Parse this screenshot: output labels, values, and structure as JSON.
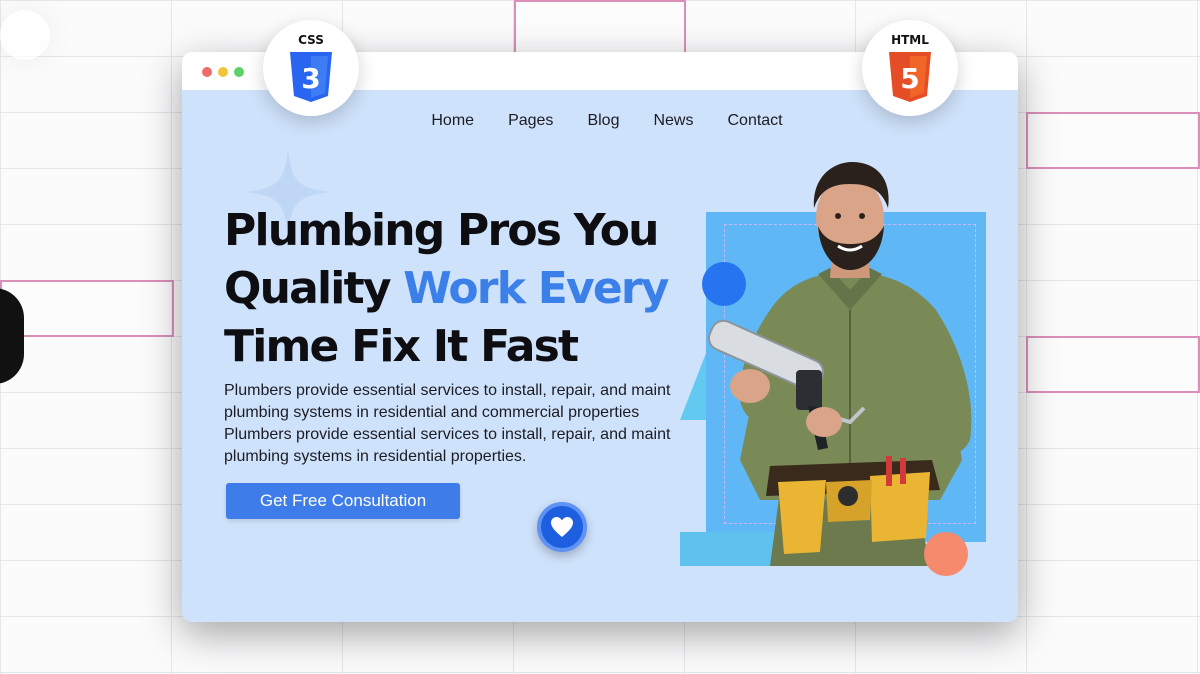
{
  "badges": {
    "css": {
      "label": "CSS",
      "shield_text": "3",
      "color": "#2965f1"
    },
    "html": {
      "label": "HTML",
      "shield_text": "5",
      "color": "#e44d26"
    }
  },
  "nav": {
    "items": [
      {
        "label": "Home"
      },
      {
        "label": "Pages"
      },
      {
        "label": "Blog"
      },
      {
        "label": "News"
      },
      {
        "label": "Contact"
      }
    ]
  },
  "hero": {
    "headline": {
      "line1": "Plumbing Pros You",
      "line2_plain": "Quality ",
      "line2_accent": "Work Every",
      "line3": "Time Fix It Fast"
    },
    "body": "Plumbers provide essential services to install, repair, and maint plumbing systems in residential and commercial properties Plumbers provide essential services to install, repair, and maint plumbing systems in residential properties.",
    "cta_label": "Get Free Consultation",
    "image_icon": "plumber-with-caulking-gun-photo"
  },
  "colors": {
    "accent": "#3b7fe8",
    "page_bg": "#cfe2fb",
    "button": "#3d7ce9"
  }
}
